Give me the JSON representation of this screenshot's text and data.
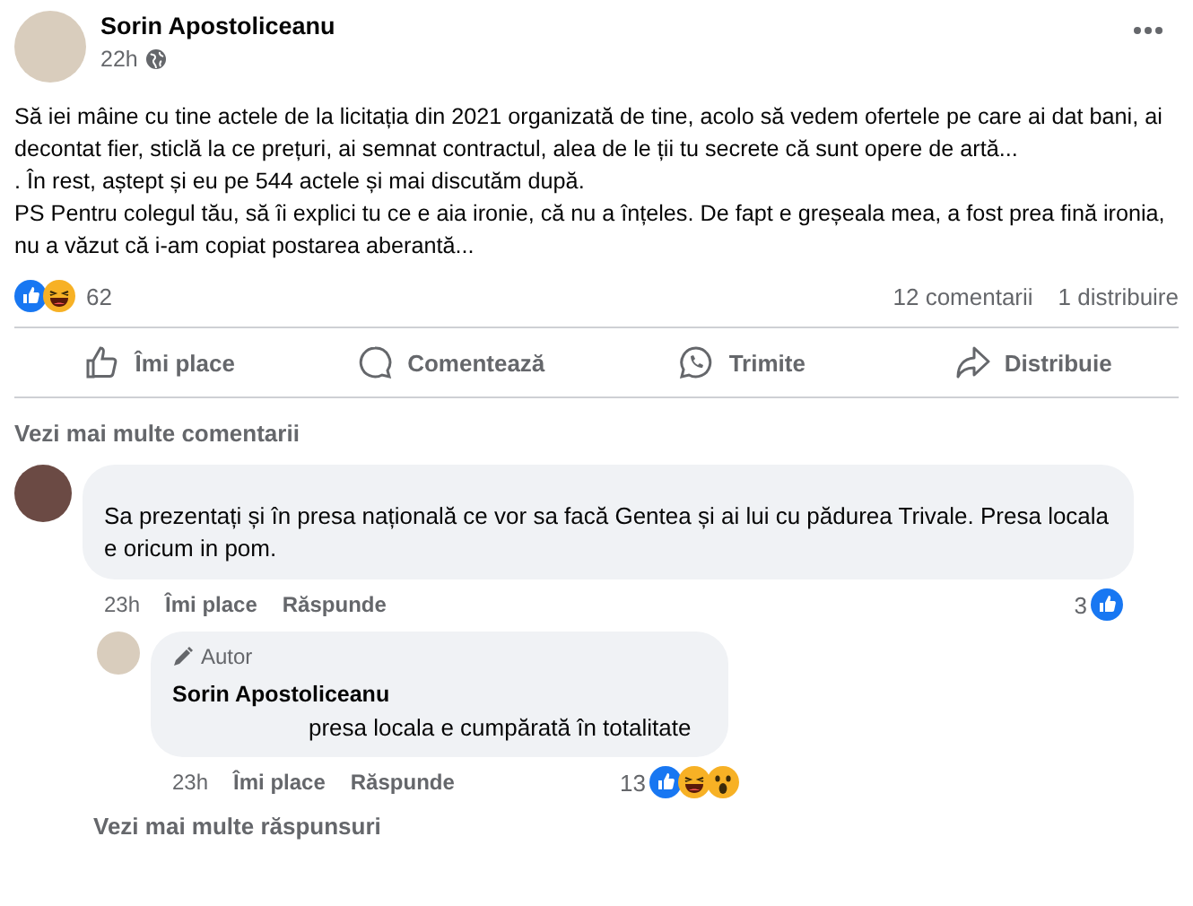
{
  "post": {
    "author": "Sorin Apostoliceanu",
    "time": "22h",
    "paragraphs": [
      "Să iei mâine cu tine actele de la licitația din 2021 organizată de tine, acolo să vedem ofertele pe care ai dat bani, ai decontat fier, sticlă la ce prețuri, ai semnat contractul, alea de le ții tu secrete că sunt opere de artă...",
      ". În rest, aștept și eu pe 544 actele și mai discutăm după.",
      "PS Pentru colegul tău, să îi explici tu ce e aia ironie, că nu a înțeles. De fapt e greșeala mea, a fost prea fină ironia, nu a văzut că i-am copiat postarea aberantă..."
    ],
    "reactions": [
      {
        "kind": "like"
      },
      {
        "kind": "haha"
      }
    ],
    "reaction_count": "62",
    "comments_count": "12 comentarii",
    "shares_count": "1 distribuire",
    "actions": [
      {
        "kind": "like",
        "label": "Îmi place"
      },
      {
        "kind": "comment",
        "label": "Comentează"
      },
      {
        "kind": "send",
        "label": "Trimite"
      },
      {
        "kind": "share",
        "label": "Distribuie"
      }
    ]
  },
  "more_comments": "Vezi mai multe comentarii",
  "comment": {
    "text": "Sa prezentați și în presa națională ce vor sa facă Gentea și ai lui cu pădurea Trivale. Presa locala e oricum in pom.",
    "time": "23h",
    "like": "Îmi place",
    "reply": "Răspunde",
    "count": "3",
    "reactions": [
      {
        "kind": "like"
      }
    ]
  },
  "reply": {
    "badge": "Autor",
    "author": "Sorin Apostoliceanu",
    "text": "presa locala e cumpărată în totalitate",
    "time": "23h",
    "like": "Îmi place",
    "reply": "Răspunde",
    "count": "13",
    "reactions": [
      {
        "kind": "like"
      },
      {
        "kind": "haha"
      },
      {
        "kind": "wow"
      }
    ]
  },
  "more_replies": "Vezi mai multe răspunsuri"
}
